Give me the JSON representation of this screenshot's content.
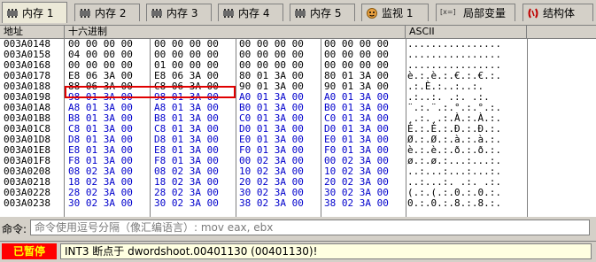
{
  "tabs": [
    {
      "label": "内存 1",
      "icon": "memory-icon"
    },
    {
      "label": "内存 2",
      "icon": "memory-icon"
    },
    {
      "label": "内存 3",
      "icon": "memory-icon"
    },
    {
      "label": "内存 4",
      "icon": "memory-icon"
    },
    {
      "label": "内存 5",
      "icon": "memory-icon"
    },
    {
      "label": "监视 1",
      "icon": "watch-icon"
    },
    {
      "label": "局部变量",
      "icon": "locals-icon"
    },
    {
      "label": "结构体",
      "icon": "struct-icon"
    }
  ],
  "locals_icon_text": "[x=]",
  "header": {
    "address": "地址",
    "hex": "十六进制",
    "ascii": "ASCII"
  },
  "rows": [
    {
      "addr": "003A0148",
      "hex": "00 00 00 00  00 00 00 00  00 00 00 00  00 00 00 00",
      "ascii": "................"
    },
    {
      "addr": "003A0158",
      "hex": "04 00 00 00  00 00 00 00  00 00 00 00  00 00 00 00",
      "ascii": "................"
    },
    {
      "addr": "003A0168",
      "hex": "00 00 00 00  01 00 00 00  00 00 00 00  00 00 00 00",
      "ascii": "................"
    },
    {
      "addr": "003A0178",
      "hex": "E8 06 3A 00  E8 06 3A 00  80 01 3A 00  80 01 3A 00",
      "ascii": "è.:.è.:.€.:.€.:."
    },
    {
      "addr": "003A0188",
      "hex": "88 06 3A 00  C8 06 3A 00  90 01 3A 00  90 01 3A 00",
      "ascii": ".:.È.:..:..:."
    },
    {
      "addr": "003A0198",
      "hex": "98 01 3A 00  98 01 3A 00  A0 01 3A 00  A0 01 3A 00",
      "ascii": ".:..:. .:. .:."
    },
    {
      "addr": "003A01A8",
      "hex": "A8 01 3A 00  A8 01 3A 00  B0 01 3A 00  B0 01 3A 00",
      "ascii": "¨.:.¨.:.°.:.°.:."
    },
    {
      "addr": "003A01B8",
      "hex": "B8 01 3A 00  B8 01 3A 00  C0 01 3A 00  C0 01 3A 00",
      "ascii": "¸.:.¸.:.À.:.À.:."
    },
    {
      "addr": "003A01C8",
      "hex": "C8 01 3A 00  C8 01 3A 00  D0 01 3A 00  D0 01 3A 00",
      "ascii": "È.:.È.:.Ð.:.Ð.:."
    },
    {
      "addr": "003A01D8",
      "hex": "D8 01 3A 00  D8 01 3A 00  E0 01 3A 00  E0 01 3A 00",
      "ascii": "Ø.:.Ø.:.à.:.à.:."
    },
    {
      "addr": "003A01E8",
      "hex": "E8 01 3A 00  E8 01 3A 00  F0 01 3A 00  F0 01 3A 00",
      "ascii": "è.:.è.:.ð.:.ð.:."
    },
    {
      "addr": "003A01F8",
      "hex": "F8 01 3A 00  F8 01 3A 00  00 02 3A 00  00 02 3A 00",
      "ascii": "ø.:.ø.:...:...:."
    },
    {
      "addr": "003A0208",
      "hex": "08 02 3A 00  08 02 3A 00  10 02 3A 00  10 02 3A 00",
      "ascii": "..:...:...:...:."
    },
    {
      "addr": "003A0218",
      "hex": "18 02 3A 00  18 02 3A 00  20 02 3A 00  20 02 3A 00",
      "ascii": "..:...:. .:. .:."
    },
    {
      "addr": "003A0228",
      "hex": "28 02 3A 00  28 02 3A 00  30 02 3A 00  30 02 3A 00",
      "ascii": "(.:.(.:.0.:.0.:."
    },
    {
      "addr": "003A0238",
      "hex": "30 02 3A 00  30 02 3A 00  38 02 3A 00  38 02 3A 00",
      "ascii": "0.:.0.:.8.:.8.:."
    }
  ],
  "command": {
    "label": "命令:",
    "placeholder": "命令使用逗号分隔（像汇编语言）: mov eax, ebx"
  },
  "status": {
    "state": "已暂停",
    "message": "INT3 断点于 dwordshoot.00401130 (00401130)!"
  },
  "colors": {
    "hex_highlight": "#0000cc",
    "paused_bg": "#ff0000",
    "paused_text": "#ffff00",
    "selection_border": "#e00000"
  }
}
